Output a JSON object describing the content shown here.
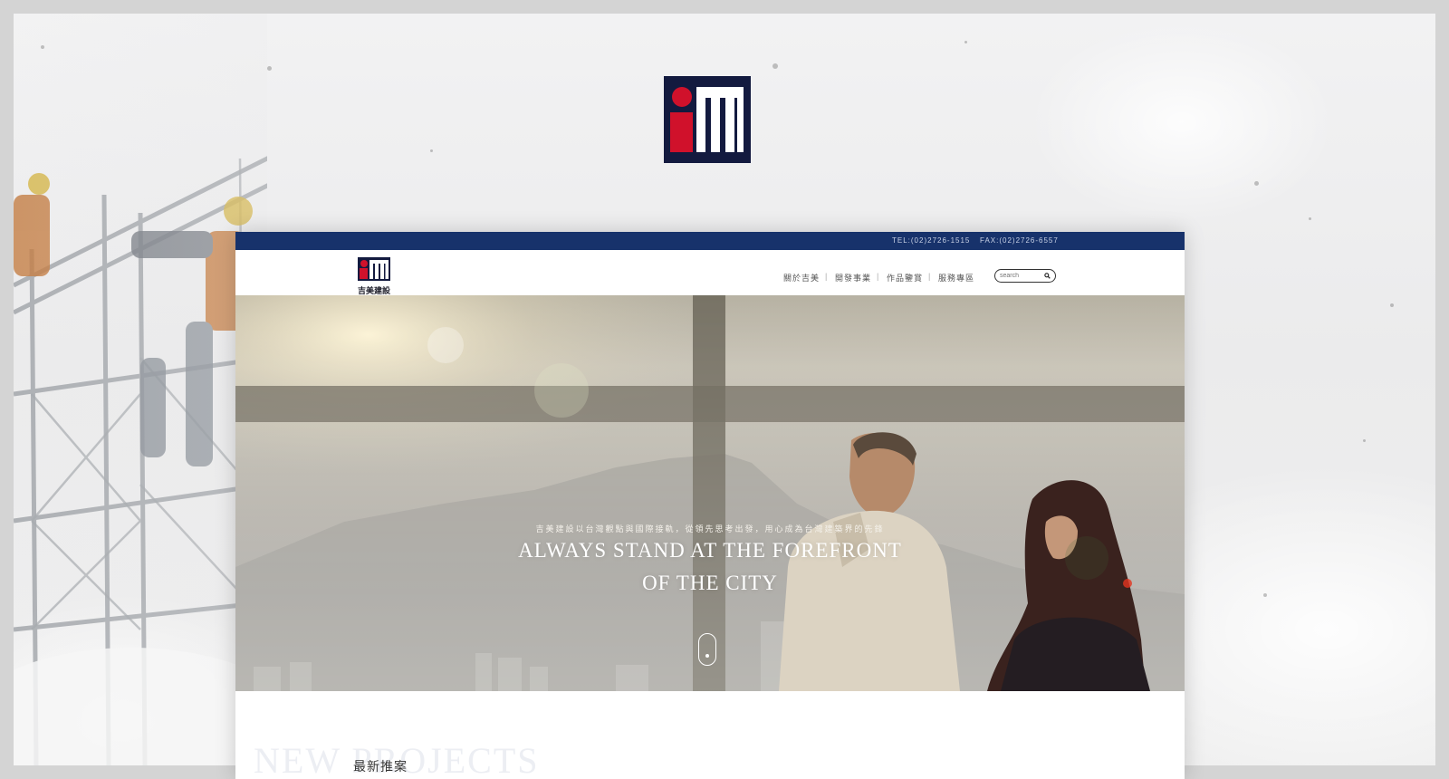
{
  "topbar": {
    "tel": "TEL:(02)2726-1515",
    "fax": "FAX:(02)2726-6557"
  },
  "brand": {
    "caption": "吉美建設",
    "colors": {
      "navy": "#131a3f",
      "red": "#d0112b",
      "topbar": "#17326b"
    }
  },
  "nav": {
    "items": [
      {
        "label": "關於吉美"
      },
      {
        "label": "開發事業"
      },
      {
        "label": "作品鑒賞"
      },
      {
        "label": "服務專區"
      }
    ],
    "separator": "|"
  },
  "search": {
    "placeholder": "search",
    "icon": "search-icon"
  },
  "hero": {
    "subtitle": "吉美建設以台灣觀點與國際接軌，從領先思考出發，用心成為台灣建築界的先鋒",
    "title_line1": "ALWAYS STAND AT THE FOREFRONT",
    "title_line2": "OF THE CITY",
    "scroll_icon": "mouse-scroll-icon"
  },
  "projects": {
    "heading": "NEW PROJECTS",
    "subheading": "最新推案"
  }
}
